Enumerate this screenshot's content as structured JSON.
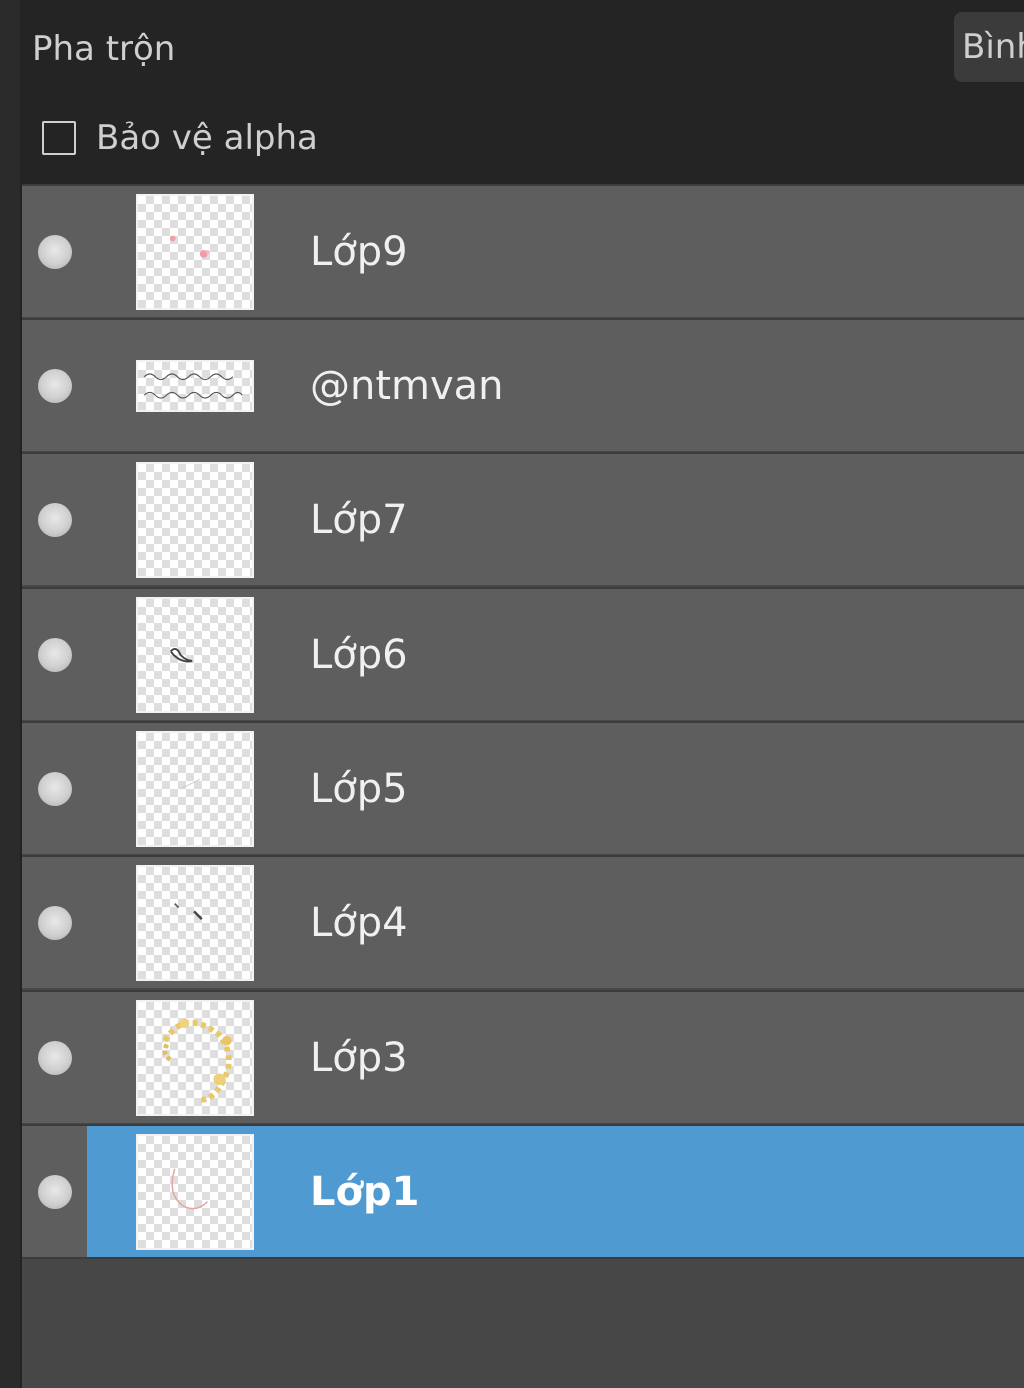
{
  "blend": {
    "label": "Pha trộn",
    "mode_value": "Bình"
  },
  "alpha_protect": {
    "label": "Bảo vệ alpha",
    "checked": false
  },
  "layers": [
    {
      "name": "Lớp9",
      "selected": false,
      "thumb": "pink-dots"
    },
    {
      "name": "@ntmvan",
      "selected": false,
      "thumb": "text-signature"
    },
    {
      "name": "Lớp7",
      "selected": false,
      "thumb": "empty"
    },
    {
      "name": "Lớp6",
      "selected": false,
      "thumb": "dark-scribble"
    },
    {
      "name": "Lớp5",
      "selected": false,
      "thumb": "faint-line"
    },
    {
      "name": "Lớp4",
      "selected": false,
      "thumb": "small-marks"
    },
    {
      "name": "Lớp3",
      "selected": false,
      "thumb": "gold-wreath"
    },
    {
      "name": "Lớp1",
      "selected": true,
      "thumb": "pink-curve"
    }
  ],
  "colors": {
    "selected_row": "#4f9bd1",
    "row_bg": "#5e5e5e",
    "panel_bg": "#242424"
  }
}
